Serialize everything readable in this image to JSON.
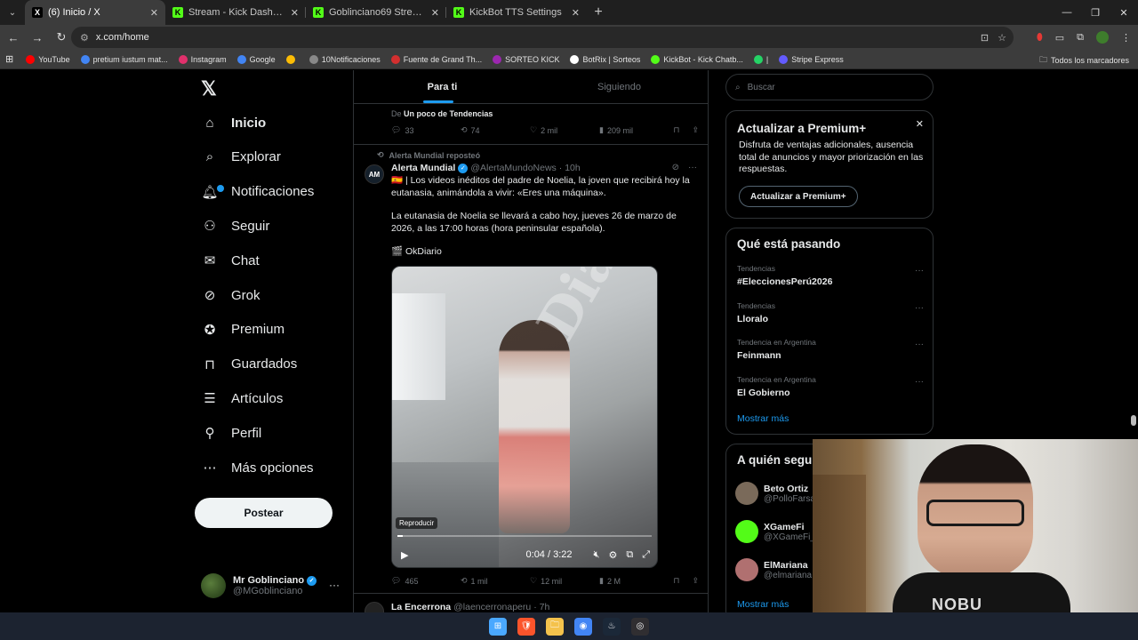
{
  "browser": {
    "tabs": [
      {
        "title": "(6) Inicio / X",
        "favicon": "X",
        "favicon_color": "#000000",
        "active": true
      },
      {
        "title": "Stream - Kick Dashboard",
        "favicon": "K",
        "favicon_color": "#53fc18",
        "active": false
      },
      {
        "title": "Goblinciano69 Stream - Watch",
        "favicon": "K",
        "favicon_color": "#53fc18",
        "active": false
      },
      {
        "title": "KickBot TTS Settings",
        "favicon": "K",
        "favicon_color": "#53fc18",
        "active": false
      }
    ],
    "url": "x.com/home",
    "bookmarks": [
      {
        "label": "YouTube",
        "color": "#ff0000"
      },
      {
        "label": "pretium iustum mat...",
        "color": "#4285f4"
      },
      {
        "label": "Instagram",
        "color": "#e1306c"
      },
      {
        "label": "Google",
        "color": "#4285f4"
      },
      {
        "label": "",
        "color": "#fbbc05"
      },
      {
        "label": "10Notificaciones",
        "color": "#888888"
      },
      {
        "label": "Fuente de Grand Th...",
        "color": "#d32f2f"
      },
      {
        "label": "SORTEO KICK",
        "color": "#9c27b0"
      },
      {
        "label": "BotRix | Sorteos",
        "color": "#ffffff"
      },
      {
        "label": "KickBot - Kick Chatb...",
        "color": "#53fc18"
      },
      {
        "label": "|",
        "color": "#25d366"
      },
      {
        "label": "Stripe Express",
        "color": "#635bff"
      }
    ],
    "all_bookmarks": "Todos los marcadores"
  },
  "sidebar": {
    "items": [
      {
        "label": "Inicio",
        "icon": "home-icon"
      },
      {
        "label": "Explorar",
        "icon": "search-icon"
      },
      {
        "label": "Notificaciones",
        "icon": "bell-icon"
      },
      {
        "label": "Seguir",
        "icon": "person-add-icon"
      },
      {
        "label": "Chat",
        "icon": "mail-icon"
      },
      {
        "label": "Grok",
        "icon": "grok-icon"
      },
      {
        "label": "Premium",
        "icon": "premium-icon"
      },
      {
        "label": "Guardados",
        "icon": "bookmark-icon"
      },
      {
        "label": "Artículos",
        "icon": "article-icon"
      },
      {
        "label": "Perfil",
        "icon": "person-icon"
      },
      {
        "label": "Más opciones",
        "icon": "more-circle-icon"
      }
    ],
    "post_button": "Postear",
    "account": {
      "name": "Mr Goblinciano",
      "handle": "@MGoblinciano"
    }
  },
  "timeline": {
    "tabs": [
      "Para ti",
      "Siguiendo"
    ],
    "previous_tweet": {
      "from_prefix": "De",
      "from_name": "Un poco de Tendencias",
      "replies": "33",
      "reposts": "74",
      "likes": "2 mil",
      "views": "209 mil"
    },
    "tweet": {
      "repost_label": "Alerta Mundial reposteó",
      "avatar_text": "AM",
      "name": "Alerta Mundial",
      "handle": "@AlertaMundoNews",
      "time": "· 10h",
      "text_1": "🇪🇸 | Los videos inéditos del padre de Noelia, la joven que recibirá hoy la eutanasia, animándola a vivir: «Eres una máquina».",
      "text_2": "La eutanasia de Noelia se llevará a cabo hoy, jueves 26 de marzo de 2026, a las 17:00 horas (hora peninsular española).",
      "text_3": "🎬 OkDiario",
      "video": {
        "watermark": "Diario",
        "tooltip": "Reproducir",
        "time": "0:04 / 3:22",
        "progress": 0.02
      },
      "replies": "465",
      "reposts": "1 mil",
      "likes": "12 mil",
      "views": "2 M"
    },
    "next_tweet": {
      "name": "La Encerrona",
      "handle": "@laencerronaperu",
      "time": "· 7h"
    }
  },
  "right": {
    "search_placeholder": "Buscar",
    "premium": {
      "title": "Actualizar a Premium+",
      "text": "Disfruta de ventajas adicionales, ausencia total de anuncios y mayor priorización en las respuestas.",
      "button": "Actualizar a Premium+"
    },
    "trends": {
      "title": "Qué está pasando",
      "items": [
        {
          "context": "Tendencias",
          "topic": "#EleccionesPerú2026"
        },
        {
          "context": "Tendencias",
          "topic": "Lloralo"
        },
        {
          "context": "Tendencia en Argentina",
          "topic": "Feinmann"
        },
        {
          "context": "Tendencia en Argentina",
          "topic": "El Gobierno"
        }
      ],
      "show_more": "Mostrar más"
    },
    "who_to_follow": {
      "title": "A quién segui",
      "items": [
        {
          "name": "Beto Ortiz",
          "handle": "@PolloFarsa",
          "color": "#7a6a5a"
        },
        {
          "name": "XGameFi",
          "handle": "@XGameFi_",
          "color": "#53fc18"
        },
        {
          "name": "ElMariana",
          "handle": "@elmariana",
          "color": "#b07070"
        }
      ],
      "show_more": "Mostrar más"
    }
  },
  "webcam": {
    "shirt_text": "NOBU"
  },
  "taskbar": {
    "icons": [
      {
        "name": "windows-start-icon",
        "color": "#4aa8ff"
      },
      {
        "name": "brave-icon",
        "color": "#fb542b"
      },
      {
        "name": "file-explorer-icon",
        "color": "#f4c24c"
      },
      {
        "name": "chrome-icon",
        "color": "#4285f4"
      },
      {
        "name": "steam-icon",
        "color": "#1b2838"
      },
      {
        "name": "obs-icon",
        "color": "#302e31"
      }
    ]
  }
}
